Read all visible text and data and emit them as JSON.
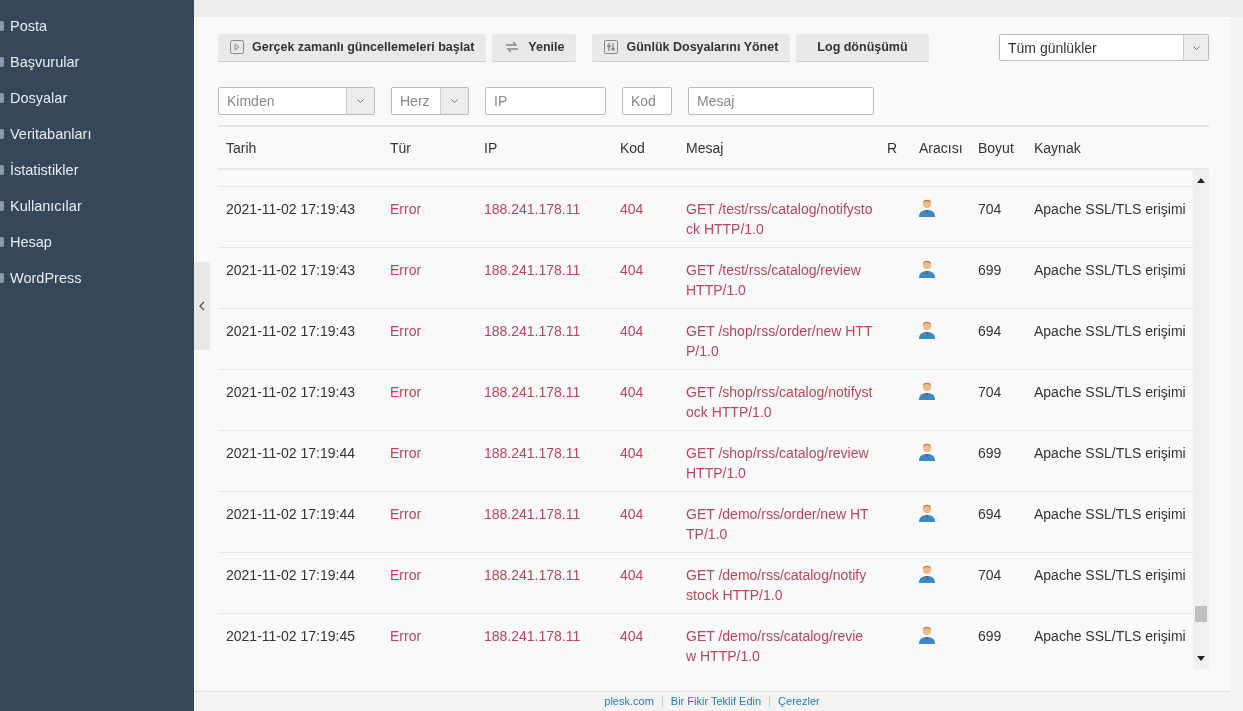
{
  "sidebar": {
    "items": [
      {
        "label": "Posta"
      },
      {
        "label": "Başvurular"
      },
      {
        "label": "Dosyalar"
      },
      {
        "label": "Veritabanları"
      },
      {
        "label": "İstatistikler"
      },
      {
        "label": "Kullanıcılar"
      },
      {
        "label": "Hesap"
      },
      {
        "label": "WordPress"
      }
    ]
  },
  "toolbar": {
    "buttons": [
      {
        "label": "Gerçek zamanlı güncellemeleri başlat"
      },
      {
        "label": "Yenile"
      },
      {
        "label": "Günlük Dosyalarını Yönet"
      },
      {
        "label": "Log dönüşümü"
      }
    ],
    "log_select": {
      "value": "Tüm günlükler"
    }
  },
  "filters": [
    {
      "kind": "select",
      "placeholder": "Kimden"
    },
    {
      "kind": "select",
      "placeholder": "Herz"
    },
    {
      "kind": "input",
      "placeholder": "IP"
    },
    {
      "kind": "input",
      "placeholder": "Kod"
    },
    {
      "kind": "input",
      "placeholder": "Mesaj"
    }
  ],
  "table": {
    "columns": [
      "Tarih",
      "Tür",
      "IP",
      "Kod",
      "Mesaj",
      "R",
      "Aracısı",
      "Boyut",
      "Kaynak"
    ],
    "rows": [
      {
        "date": "2021-11-02 17:19:43",
        "type": "Error",
        "ip": "188.241.178.11",
        "code": "404",
        "message": "GET /test/rss/catalog/notifystock HTTP/1.0",
        "size": "704",
        "source": "Apache SSL/TLS erişimi"
      },
      {
        "date": "2021-11-02 17:19:43",
        "type": "Error",
        "ip": "188.241.178.11",
        "code": "404",
        "message": "GET /test/rss/catalog/review HTTP/1.0",
        "size": "699",
        "source": "Apache SSL/TLS erişimi"
      },
      {
        "date": "2021-11-02 17:19:43",
        "type": "Error",
        "ip": "188.241.178.11",
        "code": "404",
        "message": "GET /shop/rss/order/new HTTP/1.0",
        "size": "694",
        "source": "Apache SSL/TLS erişimi"
      },
      {
        "date": "2021-11-02 17:19:43",
        "type": "Error",
        "ip": "188.241.178.11",
        "code": "404",
        "message": "GET /shop/rss/catalog/notifystock HTTP/1.0",
        "size": "704",
        "source": "Apache SSL/TLS erişimi"
      },
      {
        "date": "2021-11-02 17:19:44",
        "type": "Error",
        "ip": "188.241.178.11",
        "code": "404",
        "message": "GET /shop/rss/catalog/review HTTP/1.0",
        "size": "699",
        "source": "Apache SSL/TLS erişimi"
      },
      {
        "date": "2021-11-02 17:19:44",
        "type": "Error",
        "ip": "188.241.178.11",
        "code": "404",
        "message": "GET /demo/rss/order/new HTTP/1.0",
        "size": "694",
        "source": "Apache SSL/TLS erişimi"
      },
      {
        "date": "2021-11-02 17:19:44",
        "type": "Error",
        "ip": "188.241.178.11",
        "code": "404",
        "message": "GET /demo/rss/catalog/notifystock HTTP/1.0",
        "size": "704",
        "source": "Apache SSL/TLS erişimi"
      },
      {
        "date": "2021-11-02 17:19:45",
        "type": "Error",
        "ip": "188.241.178.11",
        "code": "404",
        "message": "GET /demo/rss/catalog/review HTTP/1.0",
        "size": "699",
        "source": "Apache SSL/TLS erişimi"
      }
    ]
  },
  "footer": {
    "links": [
      "plesk.com",
      "Bir Fikir Teklif Edin",
      "Çerezler"
    ]
  }
}
